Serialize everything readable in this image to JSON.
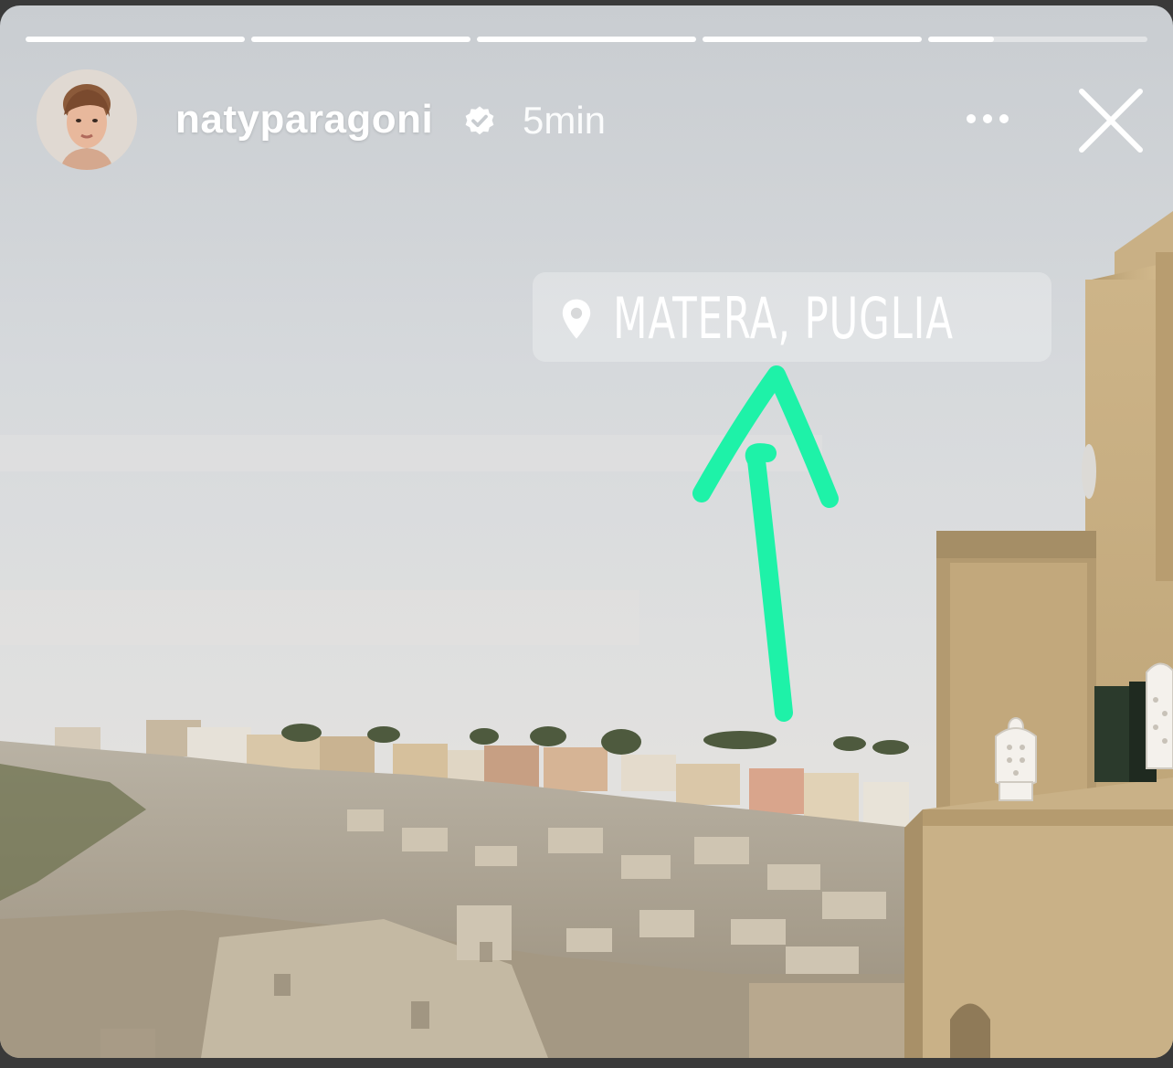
{
  "story": {
    "progress": [
      1,
      1,
      1,
      1,
      0.3
    ],
    "user": {
      "username": "natyparagoni",
      "verified": true,
      "time_ago": "5min"
    },
    "location_sticker": {
      "label": "MATERA, PUGLIA",
      "icon": "location-pin-icon"
    },
    "annotation": {
      "type": "arrow",
      "color": "#1ef2a8"
    }
  },
  "icons": {
    "more": "more-horizontal-icon",
    "close": "close-icon",
    "verified": "verified-badge-icon"
  },
  "colors": {
    "arrow": "#1ef2a8",
    "sky": "#d9dcdf",
    "stone": "#cdb78f"
  }
}
